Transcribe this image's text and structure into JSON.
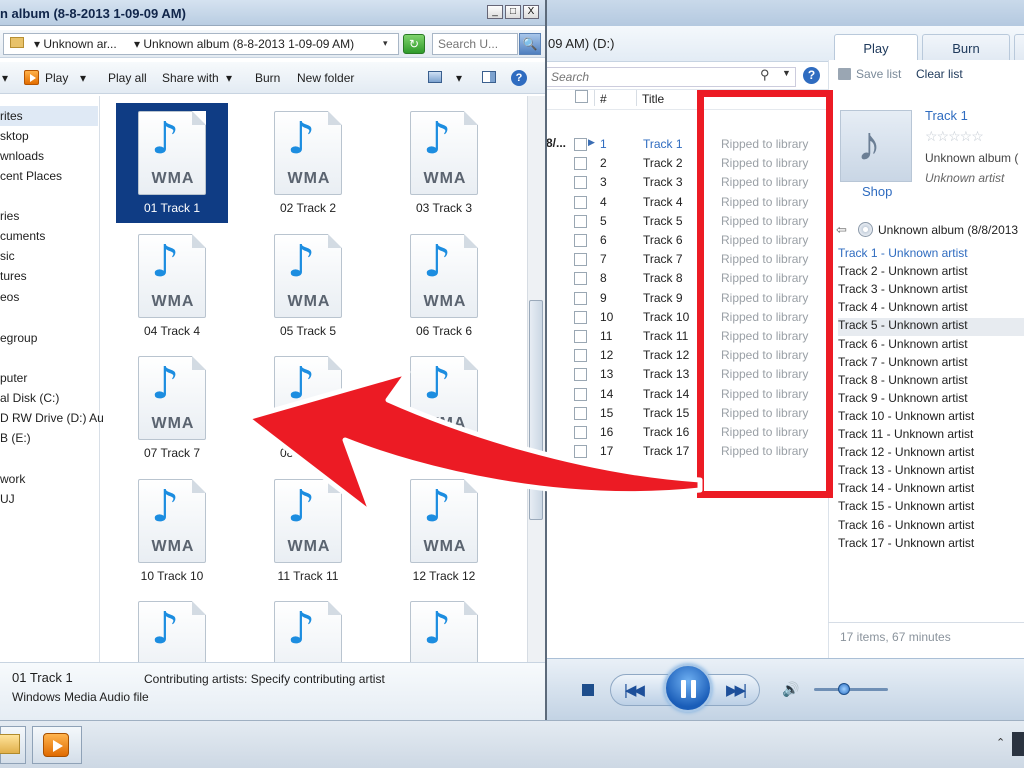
{
  "colors": {
    "accent_blue": "#2f6cc0",
    "annotation_red": "#ec1b24",
    "selected": "#0f3c84"
  },
  "explorer": {
    "title": "n album (8-8-2013 1-09-09 AM)",
    "window_buttons": {
      "minimize": "_",
      "maximize": "□",
      "close": "X"
    },
    "address": {
      "crumb1": "▾ Unknown ar...",
      "crumb2": "▾ Unknown album (8-8-2013 1-09-09 AM)",
      "dropdown": "▾",
      "refresh": "↻"
    },
    "search_placeholder": "Search U...",
    "search_button": "🔍",
    "toolbar": {
      "play": "Play",
      "play_all": "Play all",
      "share_with": "Share with",
      "burn": "Burn",
      "new_folder": "New folder",
      "help": "?"
    },
    "nav": [
      {
        "label": "rites"
      },
      {
        "label": "sktop"
      },
      {
        "label": "wnloads"
      },
      {
        "label": "cent Places"
      },
      {
        "label": "ries"
      },
      {
        "label": "cuments"
      },
      {
        "label": "sic"
      },
      {
        "label": "tures"
      },
      {
        "label": "eos"
      },
      {
        "label": "egroup"
      },
      {
        "label": "puter"
      },
      {
        "label": "al Disk (C:)"
      },
      {
        "label": "D RW Drive (D:) Au"
      },
      {
        "label": "B (E:)"
      },
      {
        "label": "work"
      },
      {
        "label": "UJ"
      }
    ],
    "files": [
      {
        "name": "01 Track 1",
        "type": "WMA"
      },
      {
        "name": "02 Track 2",
        "type": "WMA"
      },
      {
        "name": "03 Track 3",
        "type": "WMA"
      },
      {
        "name": "04 Track 4",
        "type": "WMA"
      },
      {
        "name": "05 Track 5",
        "type": "WMA"
      },
      {
        "name": "06 Track 6",
        "type": "WMA"
      },
      {
        "name": "07 Track 7",
        "type": "WMA"
      },
      {
        "name": "08 Track 8",
        "type": "WMA"
      },
      {
        "name": "09 Track 9",
        "type": "WMA"
      },
      {
        "name": "10 Track 10",
        "type": "WMA"
      },
      {
        "name": "11 Track 11",
        "type": "WMA"
      },
      {
        "name": "12 Track 12",
        "type": "WMA"
      },
      {
        "name": "",
        "type": ""
      },
      {
        "name": "",
        "type": ""
      },
      {
        "name": "",
        "type": ""
      }
    ],
    "note_glyph": "♪",
    "details": {
      "name": "01  Track 1",
      "type": "Windows Media Audio file",
      "contributing": "Contributing artists: Specify contributing artist"
    }
  },
  "wmp": {
    "address_fragment": "09 AM) (D:)",
    "tabs": {
      "play": "Play",
      "burn": "Burn"
    },
    "search_placeholder": "Search",
    "columns": {
      "num": "#",
      "title": "Title"
    },
    "album_short": "8/...",
    "tracks": [
      {
        "num": "1",
        "title": "Track 1",
        "status": "Ripped to library"
      },
      {
        "num": "2",
        "title": "Track 2",
        "status": "Ripped to library"
      },
      {
        "num": "3",
        "title": "Track 3",
        "status": "Ripped to library"
      },
      {
        "num": "4",
        "title": "Track 4",
        "status": "Ripped to library"
      },
      {
        "num": "5",
        "title": "Track 5",
        "status": "Ripped to library"
      },
      {
        "num": "6",
        "title": "Track 6",
        "status": "Ripped to library"
      },
      {
        "num": "7",
        "title": "Track 7",
        "status": "Ripped to library"
      },
      {
        "num": "8",
        "title": "Track 8",
        "status": "Ripped to library"
      },
      {
        "num": "9",
        "title": "Track 9",
        "status": "Ripped to library"
      },
      {
        "num": "10",
        "title": "Track 10",
        "status": "Ripped to library"
      },
      {
        "num": "11",
        "title": "Track 11",
        "status": "Ripped to library"
      },
      {
        "num": "12",
        "title": "Track 12",
        "status": "Ripped to library"
      },
      {
        "num": "13",
        "title": "Track 13",
        "status": "Ripped to library"
      },
      {
        "num": "14",
        "title": "Track 14",
        "status": "Ripped to library"
      },
      {
        "num": "15",
        "title": "Track 15",
        "status": "Ripped to library"
      },
      {
        "num": "16",
        "title": "Track 16",
        "status": "Ripped to library"
      },
      {
        "num": "17",
        "title": "Track 17",
        "status": "Ripped to library"
      }
    ],
    "panel": {
      "save_list": "Save list",
      "clear_list": "Clear list",
      "shop": "Shop",
      "now_playing_title": "Track 1",
      "stars": "☆☆☆☆☆",
      "album": "Unknown album (",
      "artist": "Unknown artist",
      "back_arrow": "⇦",
      "list_header": "Unknown album (8/8/2013",
      "playlist": [
        "Track 1 - Unknown artist",
        "Track 2 - Unknown artist",
        "Track 3 - Unknown artist",
        "Track 4 - Unknown artist",
        "Track 5 - Unknown artist",
        "Track 6 - Unknown artist",
        "Track 7 - Unknown artist",
        "Track 8 - Unknown artist",
        "Track 9 - Unknown artist",
        "Track 10 - Unknown artist",
        "Track 11 - Unknown artist",
        "Track 12 - Unknown artist",
        "Track 13 - Unknown artist",
        "Track 14 - Unknown artist",
        "Track 15 - Unknown artist",
        "Track 16 - Unknown artist",
        "Track 17 - Unknown artist"
      ],
      "items_count": "17 items, 67 minutes"
    },
    "controls": {
      "prev": "|◀◀",
      "next": "▶▶|",
      "volume_icon": "🔊",
      "volume": 0.4
    }
  },
  "taskbar": {
    "tray_up": "⌃"
  }
}
